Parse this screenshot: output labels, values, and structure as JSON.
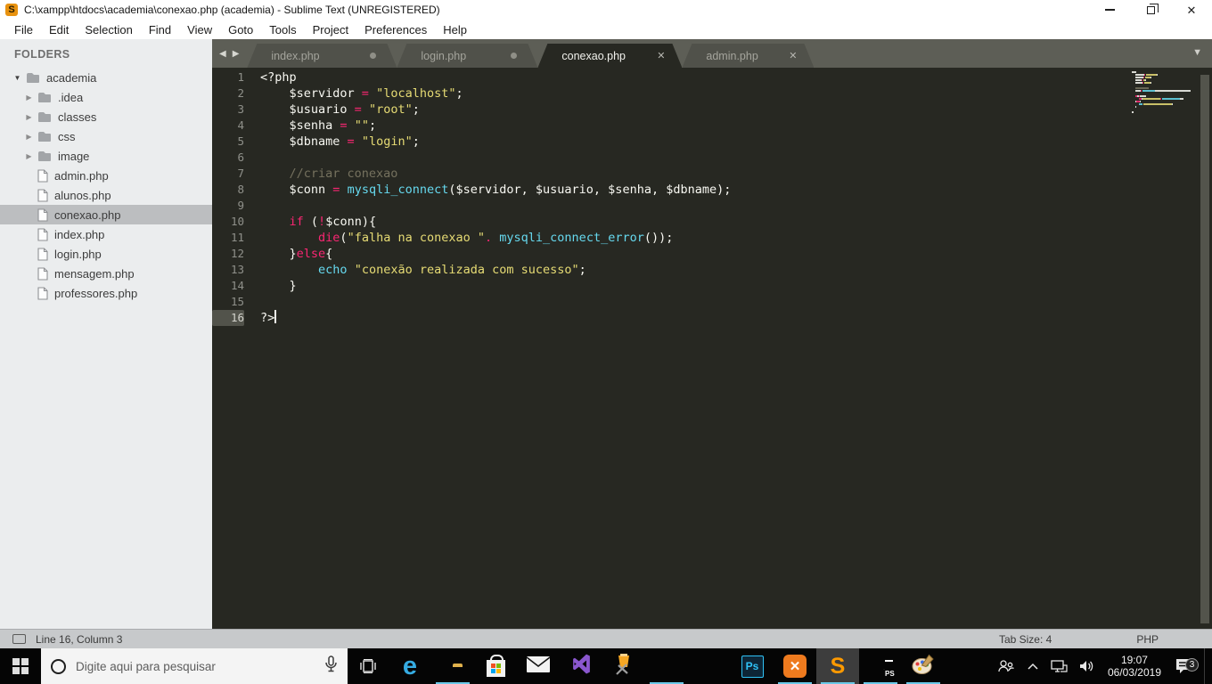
{
  "window": {
    "title": "C:\\xampp\\htdocs\\academia\\conexao.php (academia) - Sublime Text (UNREGISTERED)",
    "app_icon_glyph": "S",
    "controls": [
      "minimize",
      "restore",
      "close"
    ],
    "menu": [
      "File",
      "Edit",
      "Selection",
      "Find",
      "View",
      "Goto",
      "Tools",
      "Project",
      "Preferences",
      "Help"
    ]
  },
  "sidebar": {
    "header": "FOLDERS",
    "root_folder": "academia",
    "subfolders": [
      ".idea",
      "classes",
      "css",
      "image"
    ],
    "files": [
      "admin.php",
      "alunos.php",
      "conexao.php",
      "index.php",
      "login.php",
      "mensagem.php",
      "professores.php"
    ],
    "selected_file": "conexao.php"
  },
  "tab_bar": {
    "nav_back_icon": "◀",
    "nav_forward_icon": "▶",
    "overflow_icon": "▼",
    "close_icon": "✕",
    "tabs": [
      {
        "label": "index.php",
        "modified": true,
        "active": false,
        "closable": false
      },
      {
        "label": "login.php",
        "modified": true,
        "active": false,
        "closable": false
      },
      {
        "label": "conexao.php",
        "modified": false,
        "active": true,
        "closable": true
      },
      {
        "label": "admin.php",
        "modified": false,
        "active": false,
        "closable": true
      }
    ]
  },
  "editor": {
    "colors": {
      "w": "#f8f8f2",
      "p": "#f92672",
      "y": "#e6db74",
      "b": "#66d9ef",
      "g": "#75715e"
    },
    "cursor": {
      "line": 16,
      "column": 3
    },
    "lines": [
      {
        "n": 1,
        "tokens": [
          [
            "<?php",
            "w"
          ]
        ]
      },
      {
        "n": 2,
        "tokens": [
          [
            "    ",
            "w"
          ],
          [
            "$servidor ",
            "w"
          ],
          [
            "=",
            "p"
          ],
          [
            " ",
            "w"
          ],
          [
            "\"localhost\"",
            "y"
          ],
          [
            ";",
            "w"
          ]
        ]
      },
      {
        "n": 3,
        "tokens": [
          [
            "    ",
            "w"
          ],
          [
            "$usuario ",
            "w"
          ],
          [
            "=",
            "p"
          ],
          [
            " ",
            "w"
          ],
          [
            "\"root\"",
            "y"
          ],
          [
            ";",
            "w"
          ]
        ]
      },
      {
        "n": 4,
        "tokens": [
          [
            "    ",
            "w"
          ],
          [
            "$senha ",
            "w"
          ],
          [
            "=",
            "p"
          ],
          [
            " ",
            "w"
          ],
          [
            "\"\"",
            "y"
          ],
          [
            ";",
            "w"
          ]
        ]
      },
      {
        "n": 5,
        "tokens": [
          [
            "    ",
            "w"
          ],
          [
            "$dbname ",
            "w"
          ],
          [
            "=",
            "p"
          ],
          [
            " ",
            "w"
          ],
          [
            "\"login\"",
            "y"
          ],
          [
            ";",
            "w"
          ]
        ]
      },
      {
        "n": 6,
        "tokens": []
      },
      {
        "n": 7,
        "tokens": [
          [
            "    ",
            "w"
          ],
          [
            "//criar conexao",
            "g"
          ]
        ]
      },
      {
        "n": 8,
        "tokens": [
          [
            "    ",
            "w"
          ],
          [
            "$conn ",
            "w"
          ],
          [
            "=",
            "p"
          ],
          [
            " ",
            "w"
          ],
          [
            "mysqli_connect",
            "b"
          ],
          [
            "($servidor, $usuario, $senha, $dbname);",
            "w"
          ]
        ]
      },
      {
        "n": 9,
        "tokens": []
      },
      {
        "n": 10,
        "tokens": [
          [
            "    ",
            "w"
          ],
          [
            "if",
            "p"
          ],
          [
            " (",
            "w"
          ],
          [
            "!",
            "p"
          ],
          [
            "$conn){",
            "w"
          ]
        ]
      },
      {
        "n": 11,
        "tokens": [
          [
            "        ",
            "w"
          ],
          [
            "die",
            "p"
          ],
          [
            "(",
            "w"
          ],
          [
            "\"falha na conexao \"",
            "y"
          ],
          [
            ".",
            "p"
          ],
          [
            " ",
            "w"
          ],
          [
            "mysqli_connect_error",
            "b"
          ],
          [
            "());",
            "w"
          ]
        ]
      },
      {
        "n": 12,
        "tokens": [
          [
            "    ",
            "w"
          ],
          [
            "}",
            "w"
          ],
          [
            "else",
            "p"
          ],
          [
            "{",
            "w"
          ]
        ]
      },
      {
        "n": 13,
        "tokens": [
          [
            "        ",
            "w"
          ],
          [
            "echo",
            "b"
          ],
          [
            " ",
            "w"
          ],
          [
            "\"conexão realizada com sucesso\"",
            "y"
          ],
          [
            ";",
            "w"
          ]
        ]
      },
      {
        "n": 14,
        "tokens": [
          [
            "    ",
            "w"
          ],
          [
            "}",
            "w"
          ]
        ]
      },
      {
        "n": 15,
        "tokens": []
      },
      {
        "n": 16,
        "tokens": [
          [
            "?>",
            "w"
          ]
        ]
      }
    ]
  },
  "status_bar": {
    "position": "Line 16, Column 3",
    "tab_size": "Tab Size: 4",
    "syntax": "PHP"
  },
  "taskbar": {
    "accent": "#6ac9e8",
    "search": {
      "placeholder": "Digite aqui para pesquisar"
    },
    "apps": [
      {
        "name": "edge",
        "open": false,
        "active": false,
        "glyph": "e"
      },
      {
        "name": "file-explorer",
        "open": true,
        "active": false,
        "glyph": ""
      },
      {
        "name": "microsoft-store",
        "open": false,
        "active": false,
        "glyph": ""
      },
      {
        "name": "mail",
        "open": false,
        "active": false,
        "glyph": ""
      },
      {
        "name": "visual-studio",
        "open": false,
        "active": false,
        "glyph": ""
      },
      {
        "name": "xampp-setup",
        "open": false,
        "active": false,
        "glyph": ""
      },
      {
        "name": "chrome",
        "open": true,
        "active": false,
        "glyph": ""
      },
      {
        "name": "android-studio",
        "open": false,
        "active": false,
        "glyph": ""
      },
      {
        "name": "photoshop",
        "open": false,
        "active": false,
        "glyph": "Ps"
      },
      {
        "name": "xampp",
        "open": true,
        "active": false,
        "glyph": "✕"
      },
      {
        "name": "sublime-text",
        "open": true,
        "active": true,
        "glyph": "S"
      },
      {
        "name": "phpstorm",
        "open": true,
        "active": false,
        "glyph": "PS"
      },
      {
        "name": "paint",
        "open": true,
        "active": false,
        "glyph": ""
      }
    ],
    "tray": {
      "time": "19:07",
      "date": "06/03/2019",
      "notification_count": "3"
    }
  }
}
